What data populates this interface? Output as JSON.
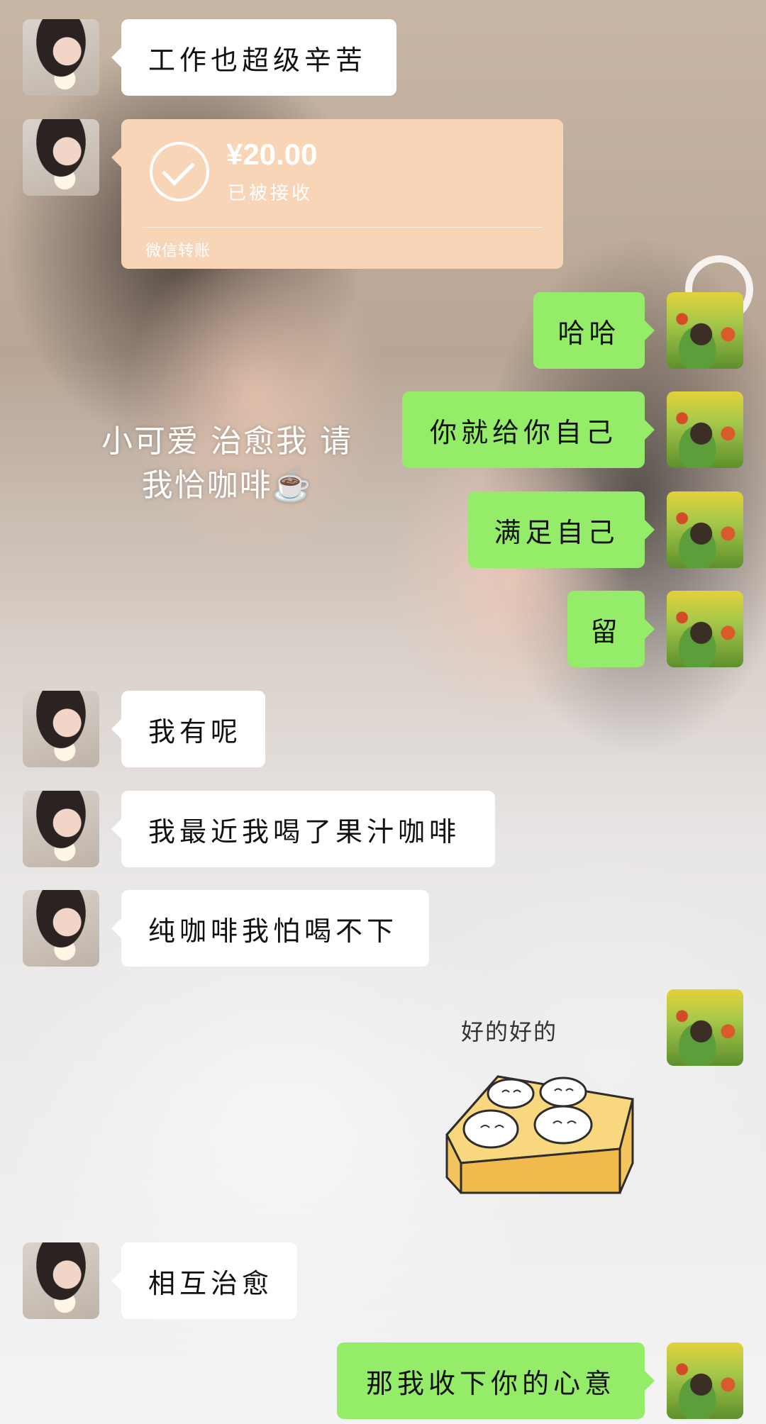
{
  "background": {
    "overlay_text": "小可爱 治愈我 请\n我恰咖啡☕"
  },
  "messages": [
    {
      "side": "left",
      "text": "工作也超级辛苦"
    },
    {
      "side": "left",
      "type": "transfer",
      "amount": "¥20.00",
      "status": "已被接收",
      "footer": "微信转账"
    },
    {
      "side": "right",
      "text": "哈哈"
    },
    {
      "side": "right",
      "text": "你就给你自己"
    },
    {
      "side": "right",
      "text": "满足自己"
    },
    {
      "side": "right",
      "text": "留"
    },
    {
      "side": "left",
      "text": "我有呢"
    },
    {
      "side": "left",
      "text": "我最近我喝了果汁咖啡"
    },
    {
      "side": "left",
      "text": "纯咖啡我怕喝不下"
    },
    {
      "side": "right",
      "type": "sticker",
      "caption": "好的好的"
    },
    {
      "side": "left",
      "text": "相互治愈"
    },
    {
      "side": "right",
      "text": "那我收下你的心意"
    }
  ],
  "colors": {
    "incoming_bubble": "#ffffff",
    "outgoing_bubble": "#95ec69",
    "transfer_card": "#f9d5b8",
    "sticker_box": "#f6c85f"
  },
  "icons": {
    "transfer_status": "check-circle-icon",
    "sticker": "dumpling-box-sticker"
  }
}
